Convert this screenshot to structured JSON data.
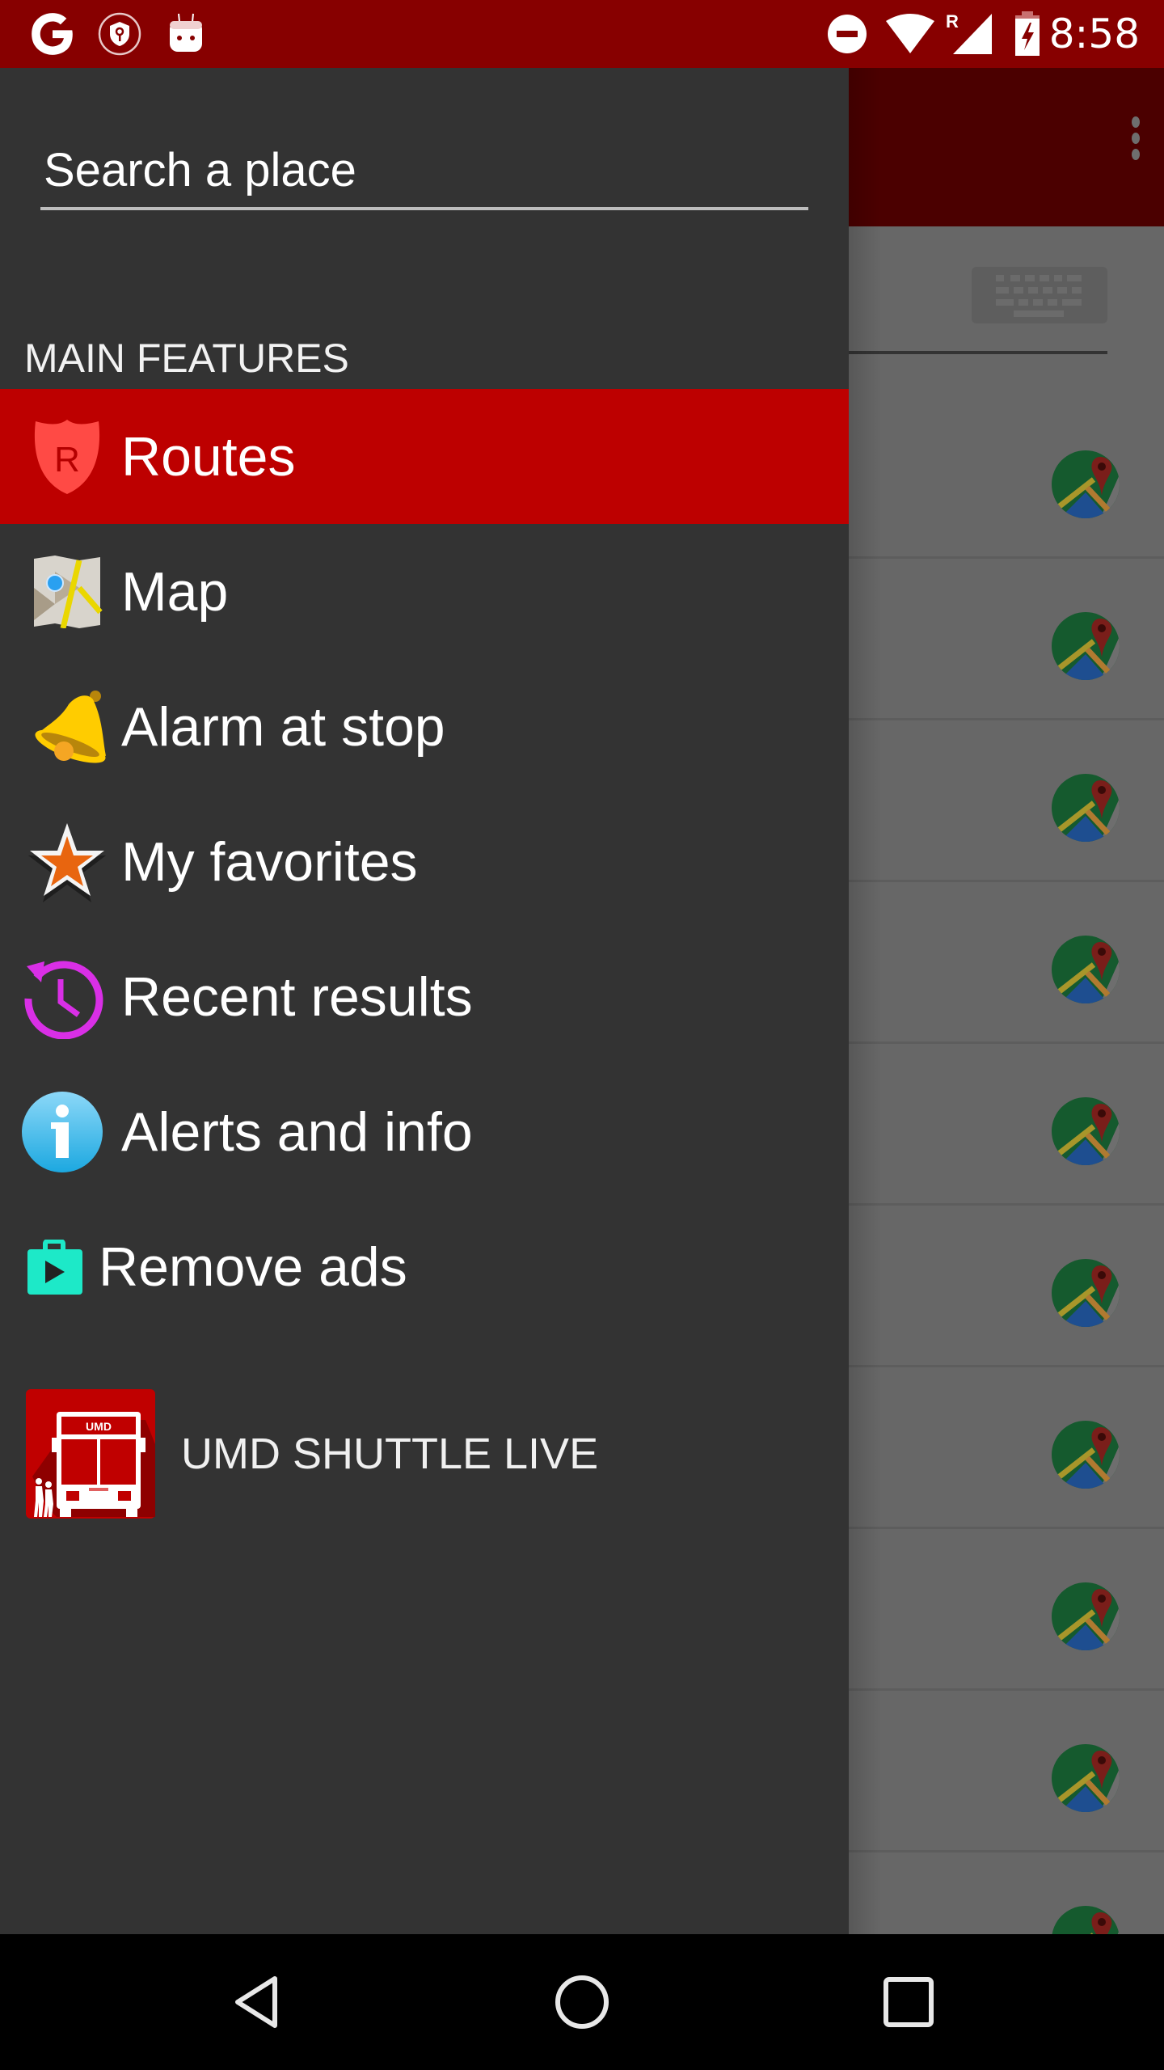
{
  "status_bar": {
    "left_icons": [
      "google-icon",
      "vpn-shield-key-icon",
      "android-robot-icon"
    ],
    "right_icons": [
      "do-not-disturb-icon",
      "wifi-icon",
      "signal-roaming-icon",
      "battery-charging-icon"
    ],
    "roaming_indicator": "R",
    "time": "8:58"
  },
  "drawer": {
    "search": {
      "placeholder": "Search a place",
      "value": ""
    },
    "section_header": "MAIN FEATURES",
    "items": [
      {
        "label": "Routes",
        "icon": "routes-shield-icon",
        "active": true
      },
      {
        "label": "Map",
        "icon": "map-icon",
        "active": false
      },
      {
        "label": "Alarm at stop",
        "icon": "bell-icon",
        "active": false
      },
      {
        "label": "My favorites",
        "icon": "star-icon",
        "active": false
      },
      {
        "label": "Recent results",
        "icon": "history-clock-icon",
        "active": false
      },
      {
        "label": "Alerts and info",
        "icon": "info-icon",
        "active": false
      },
      {
        "label": "Remove ads",
        "icon": "play-store-bag-icon",
        "active": false
      }
    ],
    "brand": {
      "name": "UMD SHUTTLE LIVE",
      "logo_text": "UMD",
      "logo_icon": "bus-logo-icon"
    }
  },
  "background_app": {
    "toolbar_icon": "overflow-menu-icon",
    "input_icon": "keyboard-icon",
    "row_count": 10,
    "row_icon": "google-maps-icon"
  },
  "colors": {
    "status_bar": "#870000",
    "toolbar_dimmed": "#4b0000",
    "drawer_bg": "#333333",
    "active_item": "#bd0000",
    "nav_bar": "#000000"
  },
  "nav_bar": {
    "buttons": [
      "back-button",
      "home-button",
      "recents-button"
    ]
  }
}
